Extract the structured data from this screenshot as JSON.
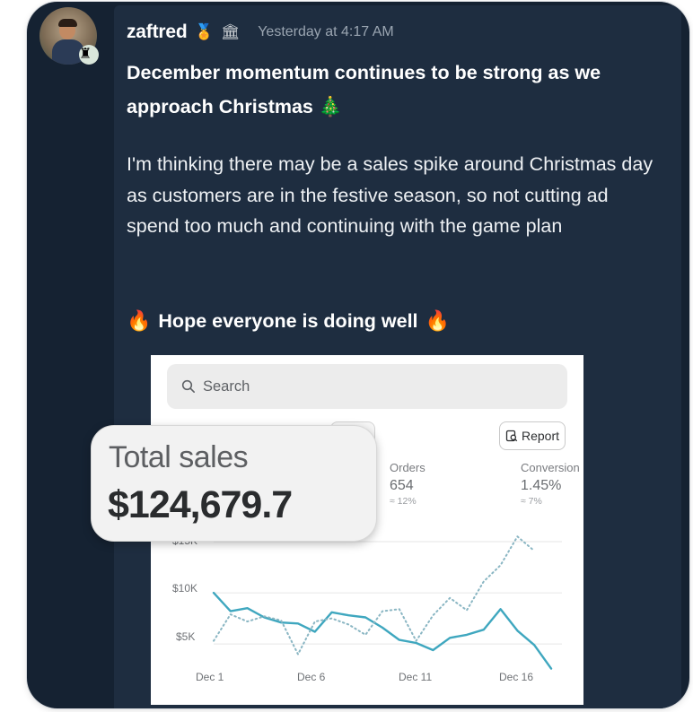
{
  "message": {
    "username": "zaftred",
    "badges": [
      "medal-icon",
      "bank-icon"
    ],
    "timestamp": "Yesterday at 4:17 AM",
    "headline": "December momentum continues to be strong as we approach Christmas 🎄",
    "paragraph": "I'm thinking there may be a sales spike around Christmas day as customers are in the festive season, so not cutting ad spend too much and continuing with the game plan",
    "closing": "Hope everyone is doing well",
    "closing_emoji": "fire-icon"
  },
  "screenshot": {
    "search_placeholder": "Search",
    "report_label": "Report",
    "total_sales_label": "Total sales",
    "total_sales_value": "$124,679.7",
    "metrics": [
      {
        "label": "Orders",
        "value": "654",
        "delta": "≈ 12%"
      },
      {
        "label": "Conversion",
        "value": "1.45%",
        "delta": "≈ 7%"
      }
    ],
    "chart_data": {
      "type": "line",
      "y_ticks": [
        "$15K",
        "$10K",
        "$5K"
      ],
      "x_ticks": [
        "Dec 1",
        "Dec 6",
        "Dec 11",
        "Dec 16"
      ],
      "ylim": [
        3000,
        15000
      ],
      "series": [
        {
          "style": "solid",
          "color": "#3fa7bf",
          "values": [
            10000,
            8200,
            8500,
            7600,
            7100,
            7000,
            6200,
            8100,
            7800,
            7600,
            6600,
            5400,
            5100,
            4400,
            5600,
            5900,
            6400,
            8400,
            6300,
            4900,
            2600
          ]
        },
        {
          "style": "dotted",
          "color": "#8ab6c3",
          "values": [
            5300,
            7900,
            7200,
            7700,
            7300,
            4000,
            7200,
            7500,
            6900,
            5900,
            8200,
            8400,
            5300,
            7800,
            9500,
            8300,
            11100,
            12700,
            15500,
            14100
          ]
        }
      ]
    }
  }
}
